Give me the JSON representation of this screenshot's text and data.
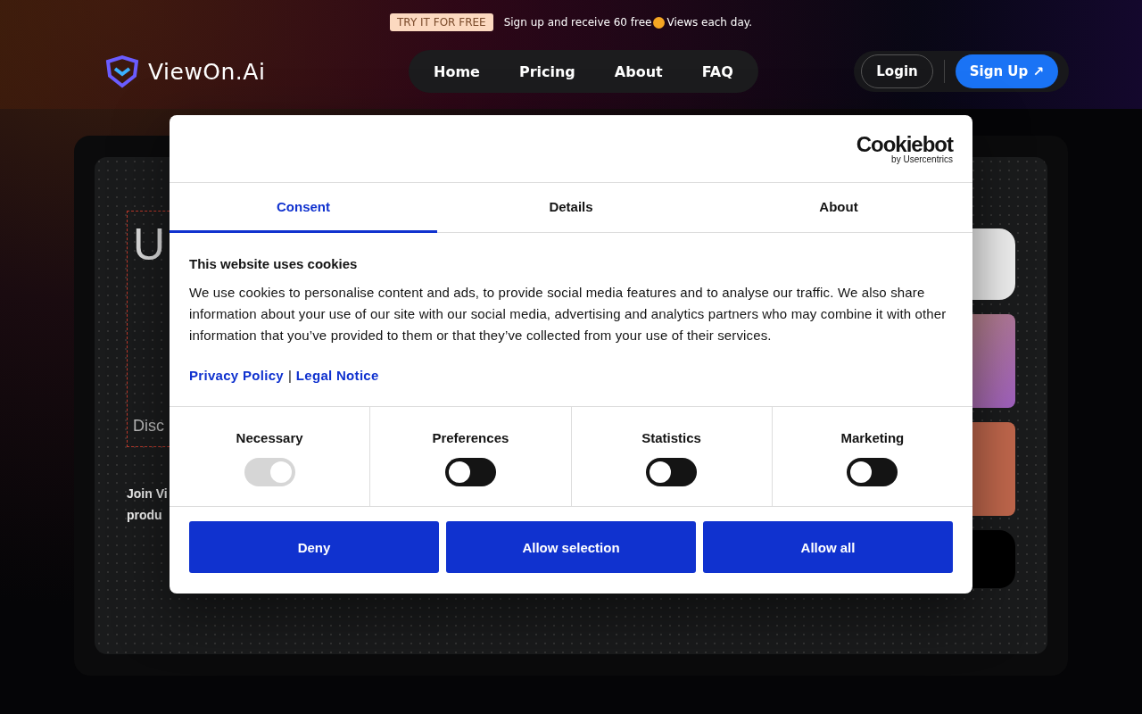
{
  "promo": {
    "badge": "TRY IT FOR FREE",
    "text_before": "Sign up and receive 60 free",
    "text_after": "Views each day."
  },
  "header": {
    "logo": "ViewOn.Ai",
    "nav": [
      {
        "label": "Home"
      },
      {
        "label": "Pricing"
      },
      {
        "label": "About"
      },
      {
        "label": "FAQ"
      }
    ],
    "login": "Login",
    "signup": "Sign Up",
    "signup_icon": "↗"
  },
  "hero": {
    "heading_letter": "U",
    "subtitle": "Disc",
    "intro_lines": [
      "Join Vi",
      "produ"
    ]
  },
  "dialog": {
    "brand": "Cookiebot",
    "brand_sub": "by Usercentrics",
    "tabs": [
      {
        "label": "Consent",
        "selected": true
      },
      {
        "label": "Details",
        "selected": false
      },
      {
        "label": "About",
        "selected": false
      }
    ],
    "title": "This website uses cookies",
    "body": "We use cookies to personalise content and ads, to provide social media features and to analyse our traffic. We also share information about your use of our site with our social media, advertising and analytics partners who may combine it with other information that you’ve provided to them or that they’ve collected from your use of their services.",
    "links": [
      "Privacy Policy",
      "Legal Notice"
    ],
    "link_separator": "|",
    "categories": [
      {
        "label": "Necessary",
        "on": true,
        "disabled": true
      },
      {
        "label": "Preferences",
        "on": false,
        "disabled": false
      },
      {
        "label": "Statistics",
        "on": false,
        "disabled": false
      },
      {
        "label": "Marketing",
        "on": false,
        "disabled": false
      }
    ],
    "buttons": [
      "Deny",
      "Allow selection",
      "Allow all"
    ]
  }
}
